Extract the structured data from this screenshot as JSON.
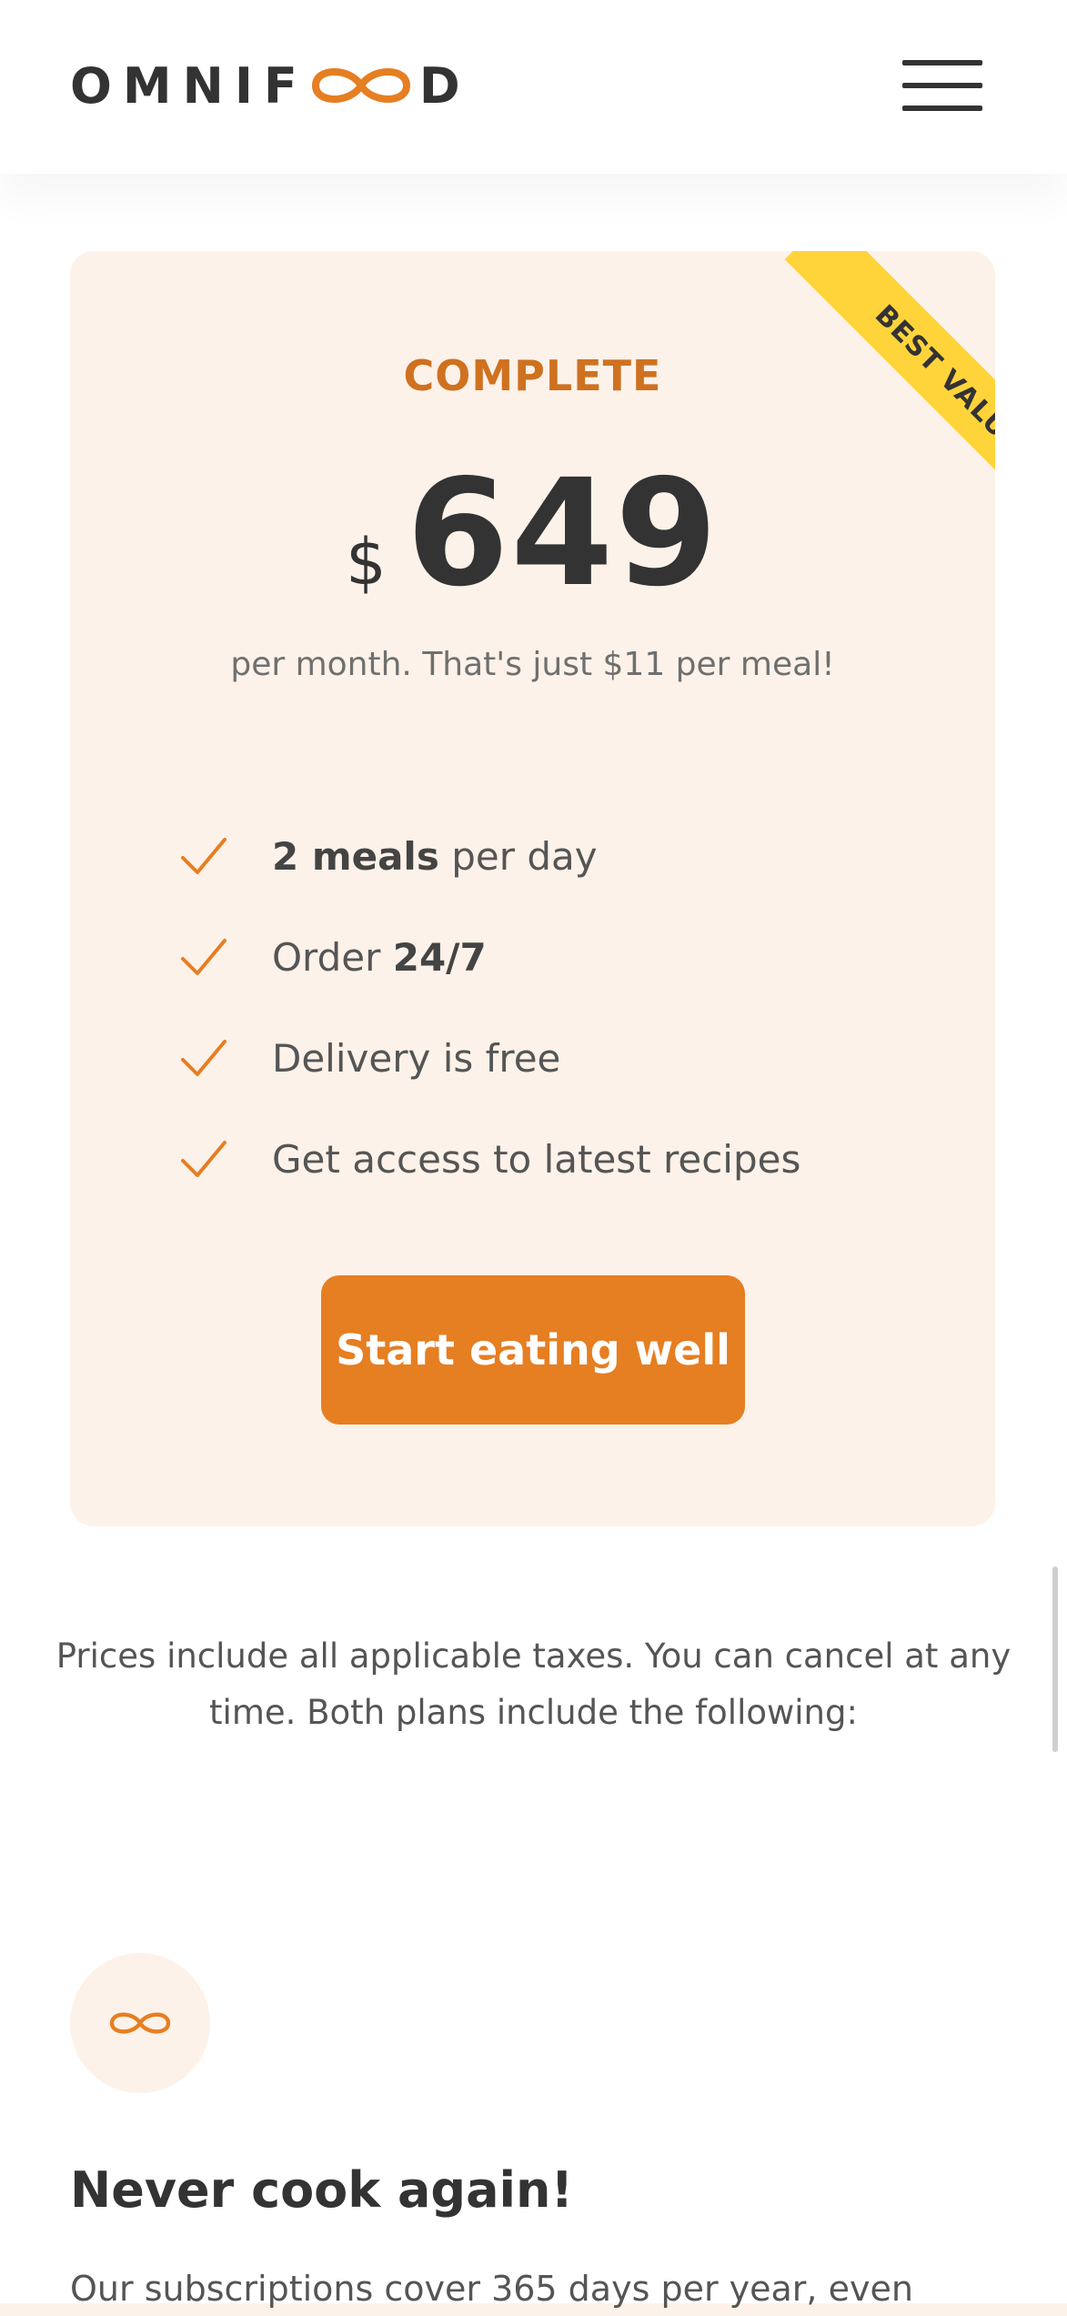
{
  "header": {
    "logo_left": "OMNIF",
    "logo_right": "D",
    "logo_icon": "infinity-icon",
    "menu_icon": "hamburger-menu-icon"
  },
  "pricing_card": {
    "ribbon": "BEST VALUE",
    "plan_name": "COMPLETE",
    "currency": "$",
    "amount": "649",
    "note": "per month. That's just $11 per meal!",
    "features": [
      {
        "bold": "2 meals",
        "text": " per day",
        "bold_first": true
      },
      {
        "text": "Order ",
        "bold": "24/7",
        "bold_first": false
      },
      {
        "text": "Delivery is free",
        "bold": "",
        "bold_first": false
      },
      {
        "text": "Get access to latest recipes",
        "bold": "",
        "bold_first": false
      }
    ],
    "cta_label": "Start eating well",
    "check_icon": "checkmark-icon"
  },
  "plans_note": "Prices include all applicable taxes. You can cancel at any time. Both plans include the following:",
  "feature_section": {
    "icon": "infinity-icon",
    "title": "Never cook again!",
    "text": "Our subscriptions cover 365 days per year, even"
  },
  "colors": {
    "primary": "#e67e22",
    "primary_dark": "#cf711f",
    "tint": "#fdf2e9",
    "ribbon": "#ffd43b",
    "text_dark": "#333333"
  }
}
